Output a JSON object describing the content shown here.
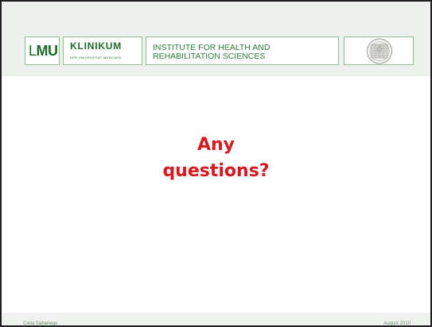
{
  "header": {
    "lmu_logo": {
      "text_l": "L",
      "text_mu": "MU"
    },
    "klinikum_logo": {
      "title": "KLINIKUM",
      "subtitle": "DER UNIVERSITÄT MÜNCHEN"
    },
    "institute": {
      "line1": "INSTITUTE FOR HEALTH AND",
      "line2": "REHABILITATION SCIENCES"
    },
    "seal_icon": "university-seal-icon"
  },
  "main": {
    "question_line1": "Any",
    "question_line2": "questions?"
  },
  "footer": {
    "author": "Carla Sabariego",
    "date": "August 2010"
  },
  "colors": {
    "accent_red": "#d7191f",
    "brand_green": "#1d6b2b",
    "header_band": "#eef0ee"
  }
}
